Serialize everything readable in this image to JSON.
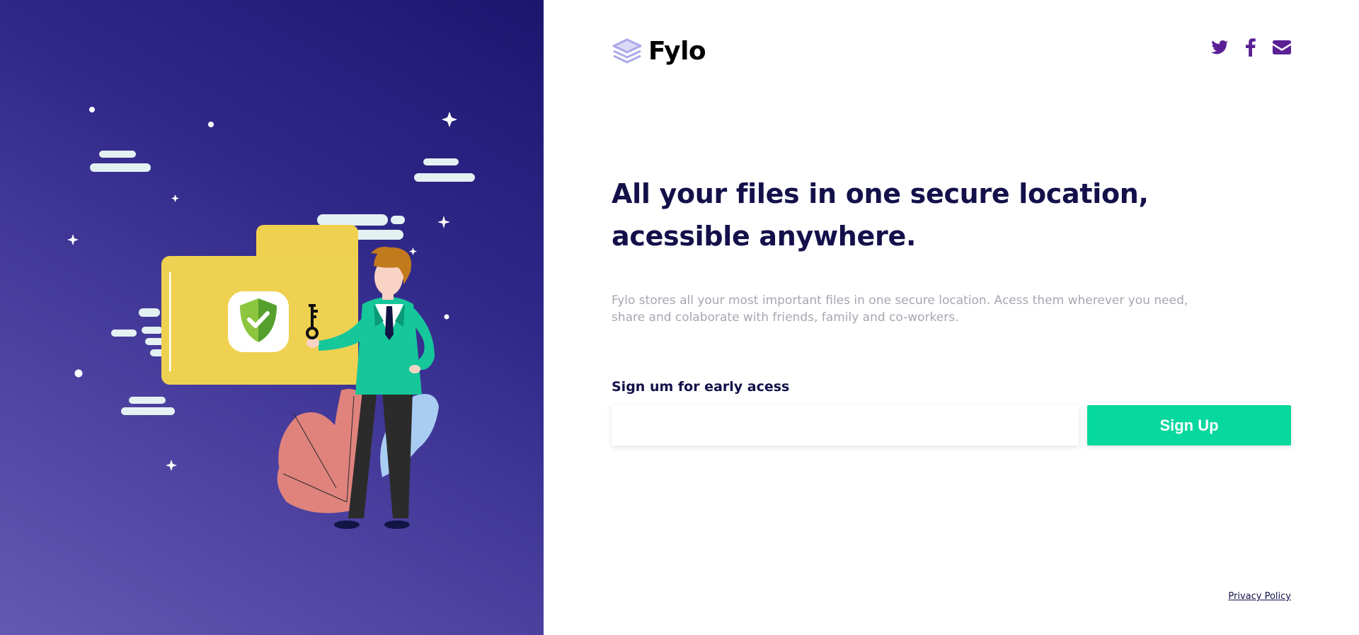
{
  "brand": {
    "name": "Fylo",
    "logo_icon": "stacked-layers-icon",
    "logo_color": "#aca8ea"
  },
  "socials": [
    {
      "name": "twitter",
      "icon": "twitter-icon"
    },
    {
      "name": "facebook",
      "icon": "facebook-icon"
    },
    {
      "name": "email",
      "icon": "envelope-icon"
    }
  ],
  "hero": {
    "headline": "All your files in one secure location, acessible anywhere.",
    "description": "Fylo stores all your most important files in one secure location. Acess them wherever you need, share and colaborate with friends, family and co-workers."
  },
  "signup": {
    "label": "Sign um for early acess",
    "email_value": "",
    "email_placeholder": "",
    "button_label": "Sign Up"
  },
  "footer": {
    "privacy_label": "Privacy Policy"
  },
  "colors": {
    "headline": "#13104a",
    "accent": "#07d89d",
    "social_icon": "#5b2095",
    "panel_gradient_start": "#6458b3",
    "panel_gradient_end": "#1c1670"
  },
  "illustration": {
    "description_icon": "secure-folder-illustration"
  }
}
